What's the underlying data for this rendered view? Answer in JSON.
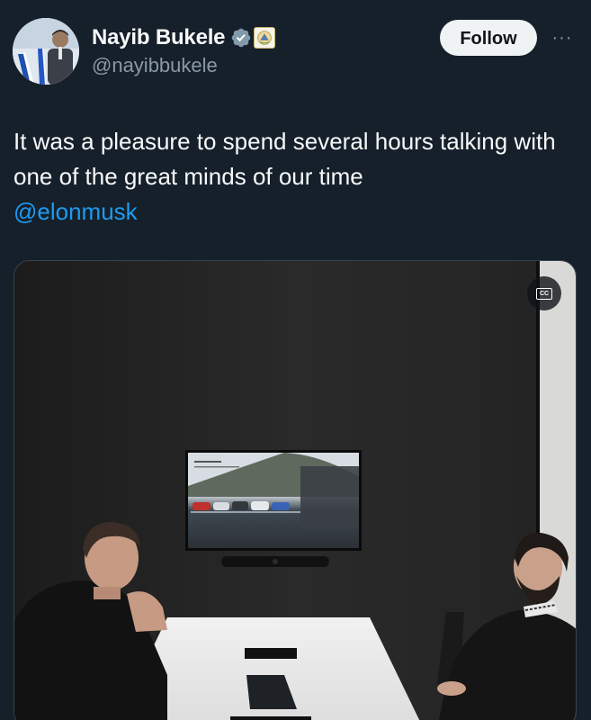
{
  "author": {
    "display_name": "Nayib Bukele",
    "handle": "@nayibbukele",
    "verified_icon": "verified-badge-icon",
    "affiliation_icon": "government-seal-icon"
  },
  "actions": {
    "follow_label": "Follow",
    "more_icon": "more-options-icon",
    "more_label": "···"
  },
  "tweet": {
    "text": "It was a pleasure to spend several hours talking with one of the great minds of our time",
    "mention": "@elonmusk"
  },
  "media": {
    "cc_label": "CC",
    "cc_icon": "closed-captions-icon"
  },
  "colors": {
    "background": "#15202b",
    "text": "#f7f9f9",
    "secondary_text": "#8b98a5",
    "link": "#1d9bf0",
    "verified": "#829aab",
    "follow_bg": "#eff3f4"
  }
}
